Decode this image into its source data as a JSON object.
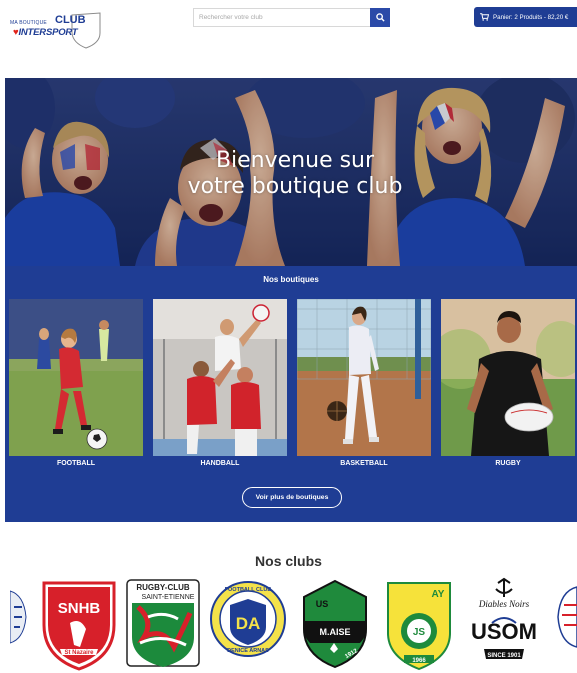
{
  "header": {
    "logo": {
      "small_text": "MA BOUTIQUE",
      "club_text": "CLUB",
      "brand_red": "♥",
      "brand_text": "INTERSPORT"
    },
    "search": {
      "placeholder": "Rechercher votre club"
    },
    "cart": {
      "label": "Panier: 2 Produits - 82,20 €"
    }
  },
  "hero": {
    "title_line1": "Bienvenue sur",
    "title_line2": "votre boutique club"
  },
  "boutiques": {
    "title": "Nos boutiques",
    "cards": [
      {
        "label": "FOOTBALL"
      },
      {
        "label": "HANDBALL"
      },
      {
        "label": "BASKETBALL"
      },
      {
        "label": "RUGBY"
      }
    ],
    "more_label": "Voir plus de boutiques"
  },
  "clubs": {
    "title": "Nos clubs",
    "logos": [
      {
        "name": "partial-left-logo"
      },
      {
        "name": "snhb-saint-nazaire-logo",
        "text_top": "SNHB",
        "text_bottom": "St Nazaire"
      },
      {
        "name": "rugby-club-saint-etienne-logo",
        "text_top": "RUGBY-CLUB",
        "text_sub": "SAINT-ETIENNE"
      },
      {
        "name": "football-club-denice-arnas-logo",
        "text_top": "FOOTBALL CLUB",
        "text_mid": "DA",
        "text_bottom": "DENICE ARNAS"
      },
      {
        "name": "us-malaise-logo",
        "text_top": "US",
        "text_mid": "M.AISE",
        "text_bottom": "1912"
      },
      {
        "name": "js-ay-logo",
        "text_top": "AY",
        "text_mid": "JS",
        "text_bottom": "1966"
      },
      {
        "name": "usom-diables-noirs-logo",
        "text_top": "Diables Noirs",
        "text_mid": "USOM",
        "text_bottom": "SINCE 1901"
      },
      {
        "name": "partial-right-logo"
      }
    ]
  },
  "colors": {
    "primary": "#1f3d94",
    "search_button": "#2b4aa8",
    "text_dark": "#333333"
  }
}
